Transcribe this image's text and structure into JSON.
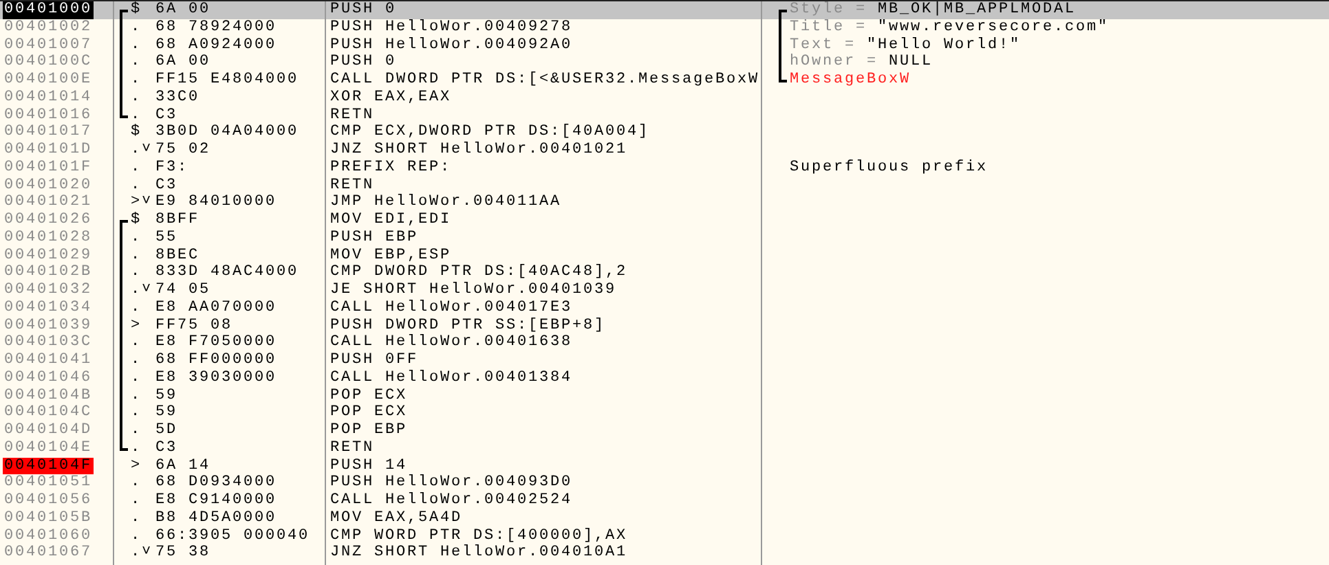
{
  "rows": [
    {
      "address": "00401000",
      "selected": true,
      "breakpoint": false,
      "bracket": {
        "kind": "start"
      },
      "marker": "$",
      "hex": "6A 00",
      "disasm": "PUSH 0",
      "comment": {
        "kind": "arg",
        "bracket": {
          "kind": "start"
        },
        "name": "Style = ",
        "value": "MB_OK|MB_APPLMODAL"
      }
    },
    {
      "address": "00401002",
      "selected": false,
      "breakpoint": false,
      "bracket": {
        "kind": "mid"
      },
      "marker": ".",
      "hex": "68 78924000",
      "disasm": "PUSH HelloWor.00409278",
      "comment": {
        "kind": "arg",
        "bracket": {
          "kind": "mid"
        },
        "name": "Title = ",
        "value": "\"www.reversecore.com\""
      }
    },
    {
      "address": "00401007",
      "selected": false,
      "breakpoint": false,
      "bracket": {
        "kind": "mid"
      },
      "marker": ".",
      "hex": "68 A0924000",
      "disasm": "PUSH HelloWor.004092A0",
      "comment": {
        "kind": "arg",
        "bracket": {
          "kind": "mid"
        },
        "name": "Text = ",
        "value": "\"Hello World!\""
      }
    },
    {
      "address": "0040100C",
      "selected": false,
      "breakpoint": false,
      "bracket": {
        "kind": "mid"
      },
      "marker": ".",
      "hex": "6A 00",
      "disasm": "PUSH 0",
      "comment": {
        "kind": "arg",
        "bracket": {
          "kind": "mid"
        },
        "name": "hOwner = ",
        "value": "NULL"
      }
    },
    {
      "address": "0040100E",
      "selected": false,
      "breakpoint": false,
      "bracket": {
        "kind": "mid"
      },
      "marker": ".",
      "hex": "FF15 E4804000",
      "disasm": "CALL DWORD PTR DS:[<&USER32.MessageBoxW",
      "comment": {
        "kind": "call",
        "bracket": {
          "kind": "end"
        },
        "text": "MessageBoxW"
      }
    },
    {
      "address": "00401014",
      "selected": false,
      "breakpoint": false,
      "bracket": {
        "kind": "mid"
      },
      "marker": ".",
      "hex": "33C0",
      "disasm": "XOR EAX,EAX"
    },
    {
      "address": "00401016",
      "selected": false,
      "breakpoint": false,
      "bracket": {
        "kind": "end"
      },
      "marker": ".",
      "hex": "C3",
      "disasm": "RETN"
    },
    {
      "address": "00401017",
      "selected": false,
      "breakpoint": false,
      "marker": "$",
      "hex": "3B0D 04A04000",
      "disasm": "CMP ECX,DWORD PTR DS:[40A004]"
    },
    {
      "address": "0040101D",
      "selected": false,
      "breakpoint": false,
      "marker": ".˅",
      "hex": "75 02",
      "disasm": "JNZ SHORT HelloWor.00401021"
    },
    {
      "address": "0040101F",
      "selected": false,
      "breakpoint": false,
      "marker": ".",
      "hex": "F3:",
      "disasm": "PREFIX REP:",
      "comment": {
        "kind": "note",
        "text": "Superfluous prefix"
      }
    },
    {
      "address": "00401020",
      "selected": false,
      "breakpoint": false,
      "marker": ".",
      "hex": "C3",
      "disasm": "RETN"
    },
    {
      "address": "00401021",
      "selected": false,
      "breakpoint": false,
      "marker": ">˅",
      "hex": "E9 84010000",
      "disasm": "JMP HelloWor.004011AA"
    },
    {
      "address": "00401026",
      "selected": false,
      "breakpoint": false,
      "bracket": {
        "kind": "start"
      },
      "marker": "$",
      "hex": "8BFF",
      "disasm": "MOV EDI,EDI"
    },
    {
      "address": "00401028",
      "selected": false,
      "breakpoint": false,
      "bracket": {
        "kind": "mid"
      },
      "marker": ".",
      "hex": "55",
      "disasm": "PUSH EBP"
    },
    {
      "address": "00401029",
      "selected": false,
      "breakpoint": false,
      "bracket": {
        "kind": "mid"
      },
      "marker": ".",
      "hex": "8BEC",
      "disasm": "MOV EBP,ESP"
    },
    {
      "address": "0040102B",
      "selected": false,
      "breakpoint": false,
      "bracket": {
        "kind": "mid"
      },
      "marker": ".",
      "hex": "833D 48AC4000",
      "disasm": "CMP DWORD PTR DS:[40AC48],2"
    },
    {
      "address": "00401032",
      "selected": false,
      "breakpoint": false,
      "bracket": {
        "kind": "mid"
      },
      "marker": ".˅",
      "hex": "74 05",
      "disasm": "JE SHORT HelloWor.00401039"
    },
    {
      "address": "00401034",
      "selected": false,
      "breakpoint": false,
      "bracket": {
        "kind": "mid"
      },
      "marker": ".",
      "hex": "E8 AA070000",
      "disasm": "CALL HelloWor.004017E3"
    },
    {
      "address": "00401039",
      "selected": false,
      "breakpoint": false,
      "bracket": {
        "kind": "mid"
      },
      "marker": ">",
      "hex": "FF75 08",
      "disasm": "PUSH DWORD PTR SS:[EBP+8]"
    },
    {
      "address": "0040103C",
      "selected": false,
      "breakpoint": false,
      "bracket": {
        "kind": "mid"
      },
      "marker": ".",
      "hex": "E8 F7050000",
      "disasm": "CALL HelloWor.00401638"
    },
    {
      "address": "00401041",
      "selected": false,
      "breakpoint": false,
      "bracket": {
        "kind": "mid"
      },
      "marker": ".",
      "hex": "68 FF000000",
      "disasm": "PUSH 0FF"
    },
    {
      "address": "00401046",
      "selected": false,
      "breakpoint": false,
      "bracket": {
        "kind": "mid"
      },
      "marker": ".",
      "hex": "E8 39030000",
      "disasm": "CALL HelloWor.00401384"
    },
    {
      "address": "0040104B",
      "selected": false,
      "breakpoint": false,
      "bracket": {
        "kind": "mid"
      },
      "marker": ".",
      "hex": "59",
      "disasm": "POP ECX"
    },
    {
      "address": "0040104C",
      "selected": false,
      "breakpoint": false,
      "bracket": {
        "kind": "mid"
      },
      "marker": ".",
      "hex": "59",
      "disasm": "POP ECX"
    },
    {
      "address": "0040104D",
      "selected": false,
      "breakpoint": false,
      "bracket": {
        "kind": "mid"
      },
      "marker": ".",
      "hex": "5D",
      "disasm": "POP EBP"
    },
    {
      "address": "0040104E",
      "selected": false,
      "breakpoint": false,
      "bracket": {
        "kind": "end"
      },
      "marker": ".",
      "hex": "C3",
      "disasm": "RETN"
    },
    {
      "address": "0040104F",
      "selected": false,
      "breakpoint": true,
      "marker": ">",
      "hex": "6A 14",
      "disasm": "PUSH 14"
    },
    {
      "address": "00401051",
      "selected": false,
      "breakpoint": false,
      "marker": ".",
      "hex": "68 D0934000",
      "disasm": "PUSH HelloWor.004093D0"
    },
    {
      "address": "00401056",
      "selected": false,
      "breakpoint": false,
      "marker": ".",
      "hex": "E8 C9140000",
      "disasm": "CALL HelloWor.00402524"
    },
    {
      "address": "0040105B",
      "selected": false,
      "breakpoint": false,
      "marker": ".",
      "hex": "B8 4D5A0000",
      "disasm": "MOV EAX,5A4D"
    },
    {
      "address": "00401060",
      "selected": false,
      "breakpoint": false,
      "marker": ".",
      "hex": "66:3905 000040",
      "disasm": "CMP WORD PTR DS:[400000],AX"
    },
    {
      "address": "00401067",
      "selected": false,
      "breakpoint": false,
      "marker": ".˅",
      "hex": "75 38",
      "disasm": "JNZ SHORT HelloWor.004010A1"
    }
  ]
}
